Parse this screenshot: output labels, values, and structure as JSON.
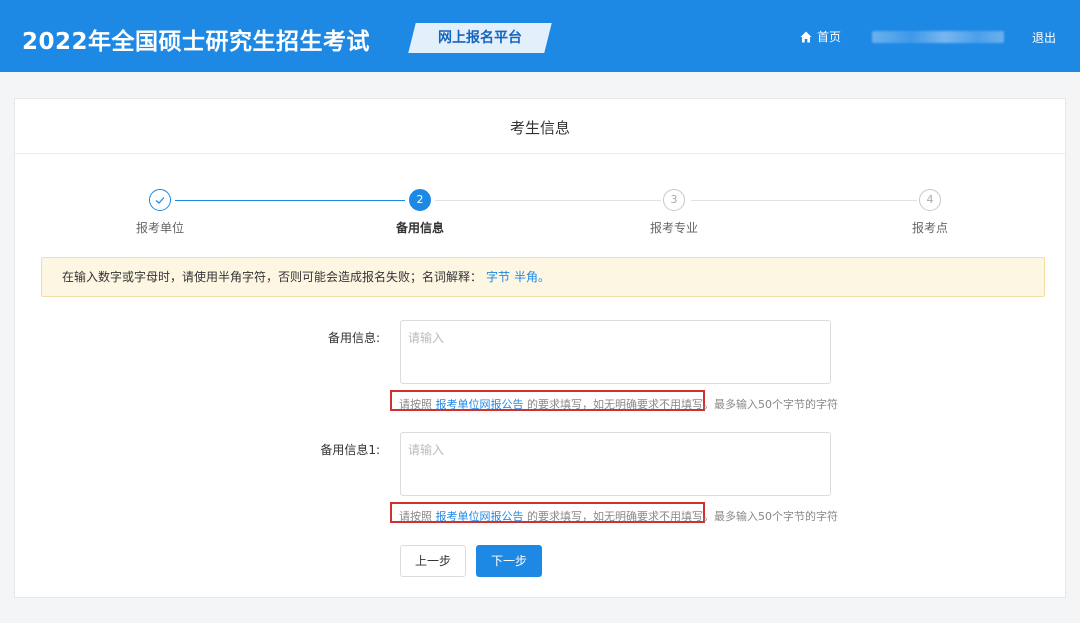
{
  "header": {
    "title": "2022年全国硕士研究生招生考试",
    "badge": "网上报名平台",
    "home_label": "首页",
    "logout_label": "退出"
  },
  "card": {
    "title": "考生信息"
  },
  "steps": [
    {
      "number": "✓",
      "label": "报考单位",
      "state": "done"
    },
    {
      "number": "2",
      "label": "备用信息",
      "state": "active"
    },
    {
      "number": "3",
      "label": "报考专业",
      "state": "todo"
    },
    {
      "number": "4",
      "label": "报考点",
      "state": "todo"
    }
  ],
  "notice": {
    "text": "在输入数字或字母时，请使用半角字符，否则可能会造成报名失败；名词解释：",
    "links": [
      "字节",
      "半角。"
    ]
  },
  "form": {
    "fields": [
      {
        "label": "备用信息:",
        "placeholder": "请输入",
        "value": "",
        "hint_prefix": "请按照",
        "hint_link": "报考单位网报公告",
        "hint_middle": "的要求填写，如无明确要求不用填写。",
        "hint_suffix": "最多输入50个字节的字符"
      },
      {
        "label": "备用信息1:",
        "placeholder": "请输入",
        "value": "",
        "hint_prefix": "请按照",
        "hint_link": "报考单位网报公告",
        "hint_middle": "的要求填写，如无明确要求不用填写。",
        "hint_suffix": "最多输入50个字节的字符"
      }
    ]
  },
  "buttons": {
    "prev": "上一步",
    "next": "下一步"
  },
  "colors": {
    "primary": "#1e88e5",
    "highlight_border": "#d32f2f",
    "notice_bg": "#fdf6e3"
  }
}
